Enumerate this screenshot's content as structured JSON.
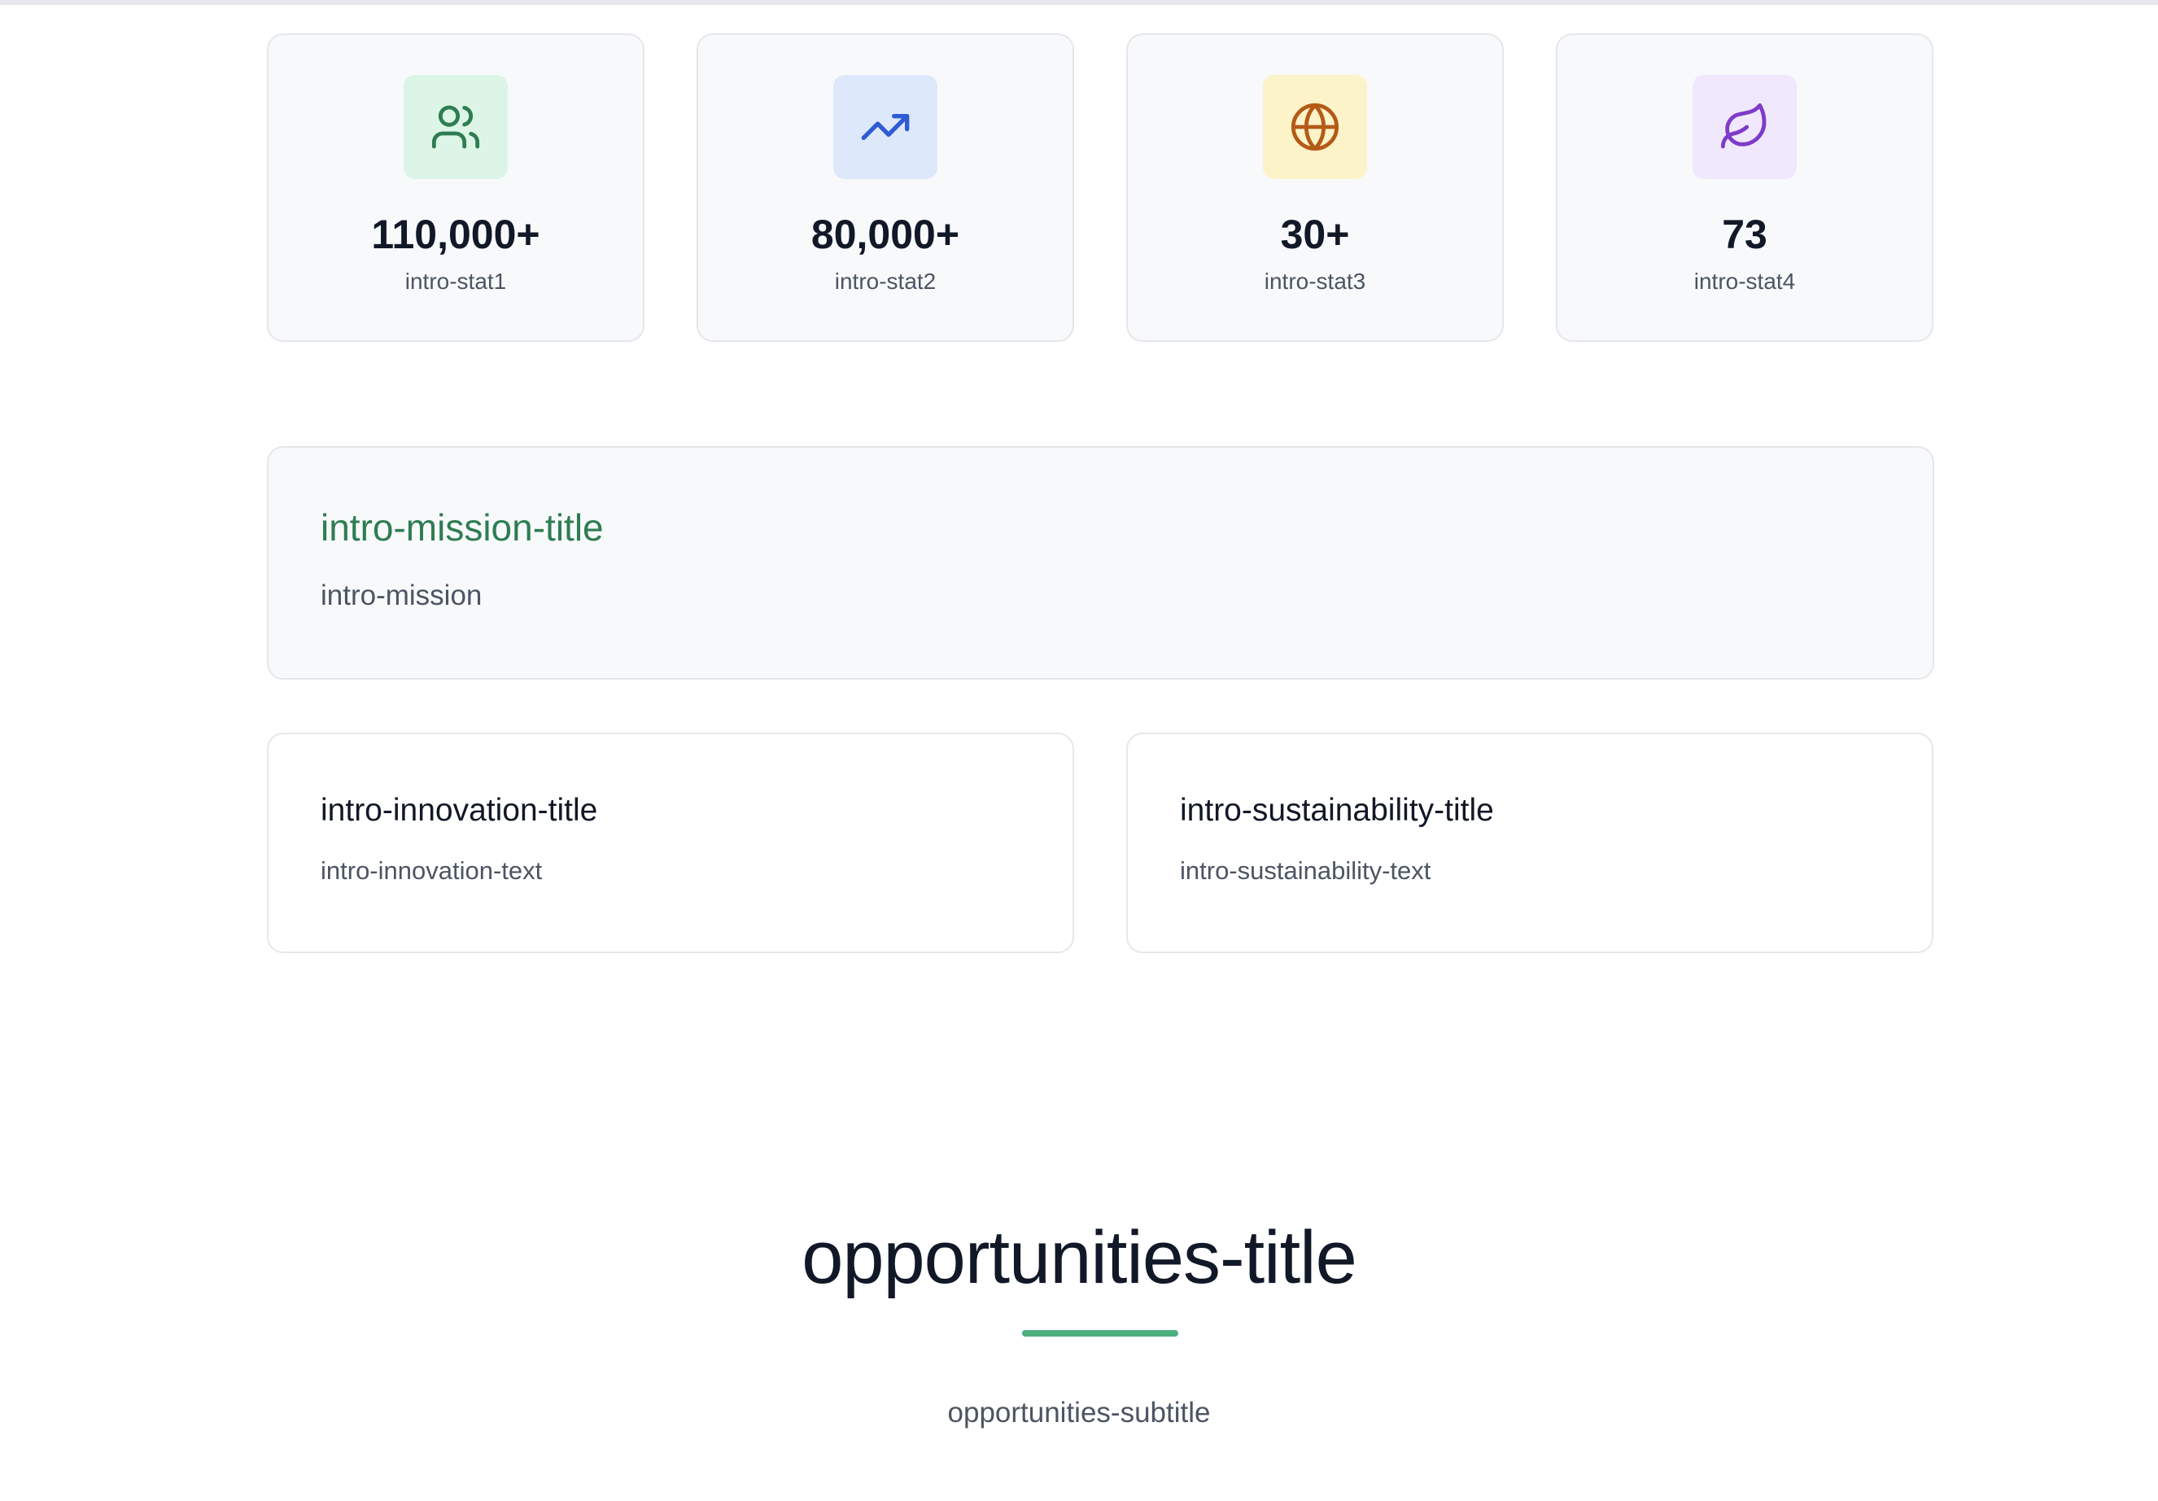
{
  "colors": {
    "accent_green": "#2e7d52",
    "underline_green": "#4caf7d"
  },
  "stats": [
    {
      "icon": "users-icon",
      "value": "110,000+",
      "label": "intro-stat1",
      "icon_bg": "#dcf5e7",
      "icon_color": "#2e7d52"
    },
    {
      "icon": "trending-up-icon",
      "value": "80,000+",
      "label": "intro-stat2",
      "icon_bg": "#dde8fb",
      "icon_color": "#2f5bd3"
    },
    {
      "icon": "globe-icon",
      "value": "30+",
      "label": "intro-stat3",
      "icon_bg": "#fdf3c9",
      "icon_color": "#b45a16"
    },
    {
      "icon": "leaf-icon",
      "value": "73",
      "label": "intro-stat4",
      "icon_bg": "#f0e8fc",
      "icon_color": "#7e3bc9"
    }
  ],
  "mission": {
    "title": "intro-mission-title",
    "text": "intro-mission"
  },
  "innovation": {
    "title": "intro-innovation-title",
    "text": "intro-innovation-text"
  },
  "sustainability": {
    "title": "intro-sustainability-title",
    "text": "intro-sustainability-text"
  },
  "opportunities": {
    "title": "opportunities-title",
    "subtitle": "opportunities-subtitle"
  }
}
